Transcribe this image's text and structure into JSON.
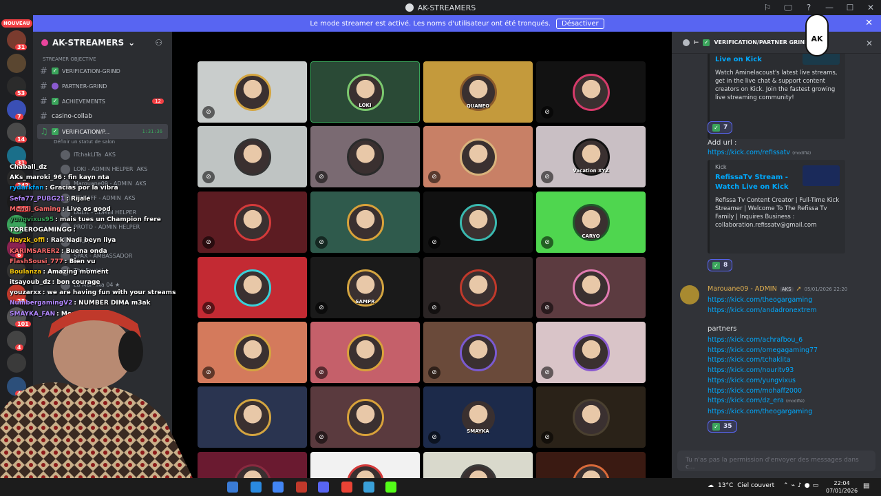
{
  "app": {
    "title": "AK-STREAMERS",
    "window_controls": [
      "⚐",
      "🖵",
      "?",
      "—",
      "☐",
      "✕"
    ]
  },
  "banner": {
    "text": "Le mode streamer est activé. Les noms d'utilisateur ont été tronqués.",
    "button": "Désactiver",
    "close": "✕"
  },
  "rail": {
    "nouveau": "NOUVEAU",
    "servers": [
      {
        "color": "#7a3b2e",
        "badge": "31"
      },
      {
        "color": "#5a4630",
        "badge": ""
      },
      {
        "color": "#2b2b2b",
        "badge": "53"
      },
      {
        "color": "#3a4fb5",
        "badge": "7"
      },
      {
        "color": "#4a4a4a",
        "badge": "14"
      },
      {
        "color": "#1a6f8a",
        "badge": "31"
      },
      {
        "color": "#2a2a2a",
        "badge": "342"
      },
      {
        "color": "#1b1b1b",
        "badge": "154"
      },
      {
        "color": "#3ba55c",
        "badge": ""
      },
      {
        "color": "#8b2252",
        "badge": "6"
      },
      {
        "color": "#333333",
        "badge": ""
      },
      {
        "color": "#c0392b",
        "badge": "28"
      },
      {
        "color": "#555555",
        "badge": "101"
      },
      {
        "color": "#444444",
        "badge": "4"
      },
      {
        "color": "#3a3a3a",
        "badge": ""
      },
      {
        "color": "#2c4f7a",
        "badge": "45"
      }
    ]
  },
  "sidebar": {
    "server_name": "AK-STREAMERS",
    "add_icon": "⚇",
    "category": "STREAMER OBJECTIVE",
    "channels": [
      {
        "name": "VERIFICATION-GRIND",
        "count": ""
      },
      {
        "name": "PARTNER-GRIND",
        "count": ""
      },
      {
        "name": "ACHIEVEMENTS",
        "count": "12"
      },
      {
        "name": "casino-collab",
        "count": ""
      }
    ],
    "voice_channel": {
      "name": "VERIFICATION/P...",
      "time": "1:31:36",
      "status": "Définir un statut de salon"
    },
    "voice_users": [
      {
        "name": "ITchakLITa",
        "tag": "AKS"
      },
      {
        "name": "LOKI - ADMIN HELPER",
        "tag": "AKS"
      },
      {
        "name": "Marouane09 - ADMIN",
        "tag": "AKS"
      },
      {
        "name": "MOHAFF - ADMIN",
        "tag": "AKS"
      },
      {
        "name": "DALIL - ADMIN HELPER",
        "tag": ""
      },
      {
        "name": "PROTO - ADMIN HELPER",
        "tag": ""
      },
      {
        "name": "BRUH",
        "tag": ""
      },
      {
        "name": "SPAX - AMBASSADOR",
        "tag": ""
      },
      {
        "name": "The Faycal",
        "tag": ""
      },
      {
        "name": "La MarTiNa 04 ★",
        "tag": ""
      }
    ]
  },
  "overlay_chat": [
    {
      "user": "Chaball_dz",
      "text": "",
      "color": "#ffffff"
    },
    {
      "user": "AKs_maroki_96",
      "text": ": fin kayn nta",
      "color": "#ffffff"
    },
    {
      "user": "rydarkfan",
      "text": ": Gracias por la vibra",
      "color": "#00a8fc"
    },
    {
      "user": "Sefa77_PUBG21",
      "text": ": Rijale",
      "color": "#b388ff"
    },
    {
      "user": "Mehdi_Gaming",
      "text": ": Live os good",
      "color": "#ff6b6b"
    },
    {
      "user": "yungvixus95",
      "text": ": mais tues un Champion frere",
      "color": "#3ba55c"
    },
    {
      "user": "TOREROGAMINGG",
      "text": ":",
      "color": "#ffffff"
    },
    {
      "user": "Nayzk_offi",
      "text": ": Rak Nadi beyn liya",
      "color": "#f1c40f"
    },
    {
      "user": "KARIMSARER2",
      "text": ": Buena onda",
      "color": "#ff6b6b"
    },
    {
      "user": "FlashSousi_777",
      "text": ": Bien vu",
      "color": "#ff6b6b"
    },
    {
      "user": "Boulanza",
      "text": ": Amazing moment",
      "color": "#f1c40f"
    },
    {
      "user": "itsayoub_dz",
      "text": ": bon courage",
      "color": "#ffffff"
    },
    {
      "user": "youzarxx",
      "text": ": we are having fun with your streams",
      "color": "#ffffff"
    },
    {
      "user": "NumbergamingV2",
      "text": ": NUMBER DIMA m3ak",
      "color": "#b388ff"
    },
    {
      "user": "SMAYKA_FAN",
      "text": ": More hearts",
      "color": "#b388ff"
    }
  ],
  "grid": {
    "tiles": [
      {
        "bg": "#c9cdcc",
        "ring": "#d4a540",
        "label": "",
        "mute": "⊘"
      },
      {
        "bg": "#2a4a36",
        "ring": "#7bc96f",
        "label": "LOKI",
        "mute": ""
      },
      {
        "bg": "#c49a3c",
        "ring": "#8b5a2b",
        "label": "QUANEO",
        "mute": ""
      },
      {
        "bg": "#121212",
        "ring": "#d63a6a",
        "label": "",
        "mute": "⊘"
      },
      {
        "bg": "#bfc4c3",
        "ring": "#333333",
        "label": "",
        "mute": "⊘"
      },
      {
        "bg": "#7a6a72",
        "ring": "#2a2a2a",
        "label": "",
        "mute": "⊘"
      },
      {
        "bg": "#c88066",
        "ring": "#d9b37c",
        "label": "",
        "mute": "⊘"
      },
      {
        "bg": "#c9bfc4",
        "ring": "#111111",
        "label": "Vacation XYZ",
        "mute": "⊘"
      },
      {
        "bg": "#5c1c22",
        "ring": "#d43a3a",
        "label": "",
        "mute": "⊘"
      },
      {
        "bg": "#2f5a4c",
        "ring": "#d9a23a",
        "label": "",
        "mute": "⊘"
      },
      {
        "bg": "#111111",
        "ring": "#3ab9b0",
        "label": "",
        "mute": "⊘"
      },
      {
        "bg": "#4fd64f",
        "ring": "#1f5a2a",
        "label": "CARYO",
        "mute": "⊘"
      },
      {
        "bg": "#c32a33",
        "ring": "#3ad0d9",
        "label": "",
        "mute": "⊘"
      },
      {
        "bg": "#1a1a1a",
        "ring": "#d4a540",
        "label": "SAMPR",
        "mute": "⊘"
      },
      {
        "bg": "#2a2424",
        "ring": "#c0392b",
        "label": "",
        "mute": "⊘"
      },
      {
        "bg": "#5c3b40",
        "ring": "#e07ab0",
        "label": "",
        "mute": "⊘"
      },
      {
        "bg": "#d47a5c",
        "ring": "#d4a540",
        "label": "",
        "mute": "⊘"
      },
      {
        "bg": "#c5606a",
        "ring": "#d9a23a",
        "label": "",
        "mute": "⊘"
      },
      {
        "bg": "#6a4a3a",
        "ring": "#7a5ad0",
        "label": "",
        "mute": "⊘"
      },
      {
        "bg": "#d9c4c8",
        "ring": "#8a5ad0",
        "label": "",
        "mute": "⊘"
      },
      {
        "bg": "#2a3450",
        "ring": "#d4a540",
        "label": "",
        "mute": ""
      },
      {
        "bg": "#5a3a3e",
        "ring": "#d9a23a",
        "label": "",
        "mute": "⊘"
      },
      {
        "bg": "#1c2a4a",
        "ring": "#1c2a4a",
        "label": "SMAYKA",
        "mute": "⊘"
      },
      {
        "bg": "#2a2218",
        "ring": "#4a4030",
        "label": "",
        "mute": "⊘"
      },
      {
        "bg": "#6a1a30",
        "ring": "#8a2a40",
        "label": "",
        "mute": ""
      },
      {
        "bg": "#f2f2f2",
        "ring": "#d43a3a",
        "label": "",
        "mute": ""
      },
      {
        "bg": "#d9d9cc",
        "ring": "#3a3a3a",
        "label": "",
        "mute": ""
      },
      {
        "bg": "#3a1a12",
        "ring": "#d96a3a",
        "label": "",
        "mute": ""
      }
    ]
  },
  "right": {
    "channel": "VERIFICATION/PARTNER GRIND",
    "close": "✕",
    "embed1": {
      "title": "Live on Kick",
      "desc": "Watch Aminelacoust's latest live streams, get in the live chat & support content creators on Kick. Join the fastest growing live streaming community!"
    },
    "react1": "7",
    "addurl": "Add url :",
    "url1": "https://kick.com/refissatv",
    "modified": "(modifié)",
    "embed2": {
      "provider": "Kick",
      "title": "RefissaTv Stream - Watch Live on Kick",
      "desc": "Refissa Tv Content Creator | Full-Time Kick Streamer | Welcome To The Refissa Tv Family | Inquires Business : collaboration.refissatv@gmail.com"
    },
    "react2": "8",
    "author": {
      "name": "Marouane09 - ADMIN",
      "tag": "AKS",
      "time": "05/01/2026 22:20"
    },
    "links1": [
      "https://kick.com/theogargaming",
      "https://kick.com/andadronextrem"
    ],
    "partners_label": "partners",
    "links2": [
      "https://kick.com/achrafbou_6",
      "https://kick.com/omegagaming77",
      "https://kick.com/tchaklita",
      "https://kick.com/nouritv93",
      "https://kick.com/yungvixus",
      "https://kick.com/mohaff2000",
      "https://kick.com/dz_era"
    ],
    "link_last": "https://kick.com/theogargaming",
    "react3": "35",
    "input_placeholder": "Tu n'as pas la permission d'envoyer des messages dans c..."
  },
  "badge_ak": "AK",
  "taskbar": {
    "weather": "13°C",
    "weather_text": "Ciel couvert",
    "time": "22:04",
    "date": "07/01/2026",
    "icons": [
      "#3a7bd5",
      "#2a8ae0",
      "#4285f4",
      "#c0392b",
      "#5865f2",
      "#ea4335",
      "#3aa0d9",
      "#53fc18"
    ]
  }
}
